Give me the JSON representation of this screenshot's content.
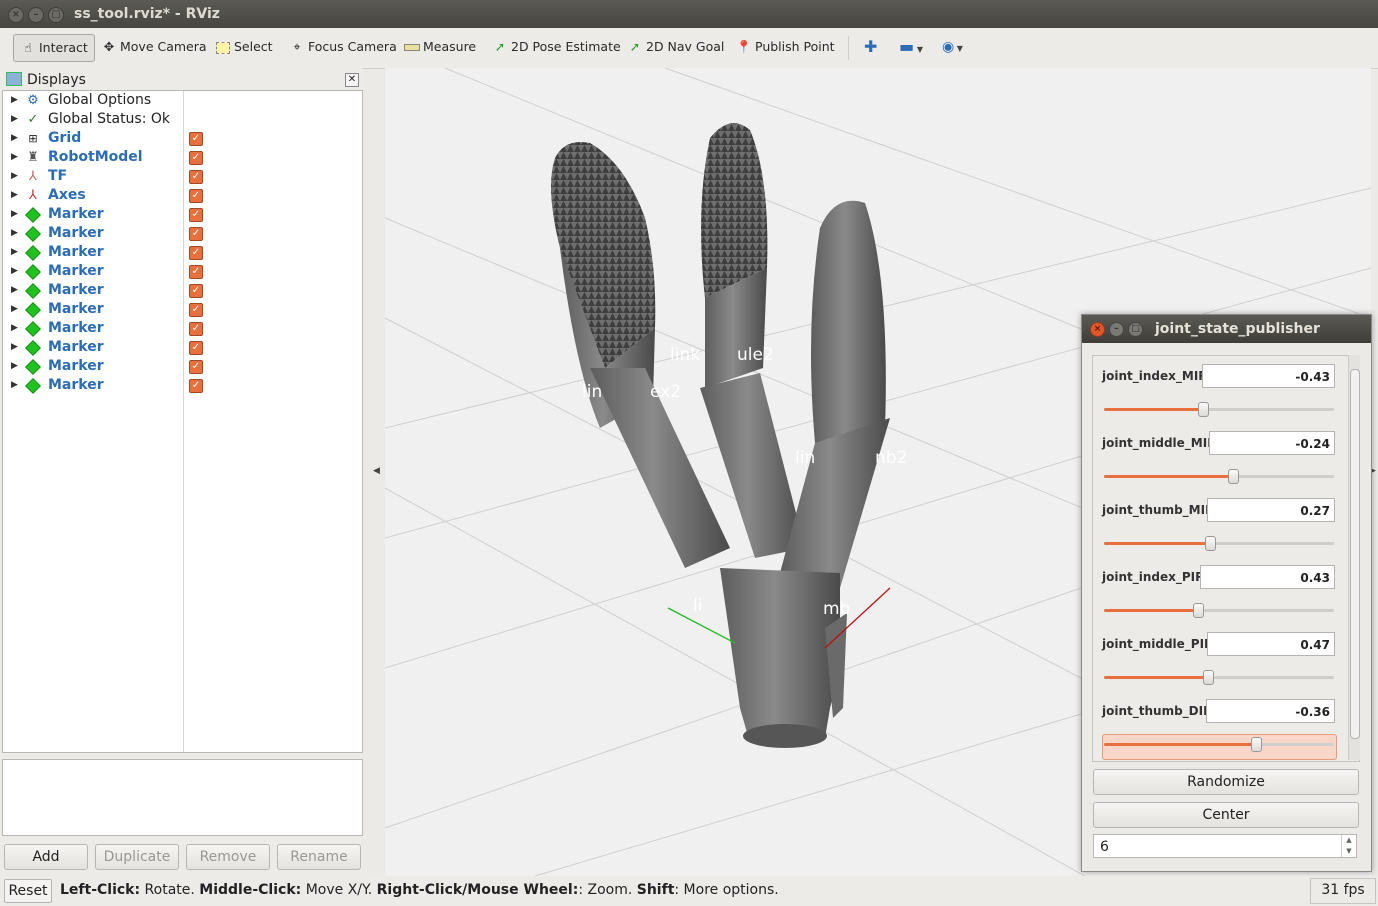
{
  "window": {
    "title": "ss_tool.rviz* - RViz"
  },
  "toolbar": {
    "items": [
      {
        "label": "Interact",
        "icon": "hand-icon"
      },
      {
        "label": "Move Camera",
        "icon": "move-camera-icon"
      },
      {
        "label": "Select",
        "icon": "select-icon"
      },
      {
        "label": "Focus Camera",
        "icon": "focus-camera-icon"
      },
      {
        "label": "Measure",
        "icon": "ruler-icon"
      },
      {
        "label": "2D Pose Estimate",
        "icon": "green-arrow-icon"
      },
      {
        "label": "2D Nav Goal",
        "icon": "green-arrow-icon"
      },
      {
        "label": "Publish Point",
        "icon": "map-pin-icon"
      }
    ]
  },
  "displays": {
    "title": "Displays",
    "rows": [
      {
        "label": "Global Options",
        "icon": "gear-icon",
        "checked": null
      },
      {
        "label": "Global Status: Ok",
        "icon": "checkmark-icon",
        "checked": null
      },
      {
        "label": "Grid",
        "icon": "grid-icon",
        "checked": true
      },
      {
        "label": "RobotModel",
        "icon": "robot-icon",
        "checked": true
      },
      {
        "label": "TF",
        "icon": "tf-icon",
        "checked": true
      },
      {
        "label": "Axes",
        "icon": "axes-icon",
        "checked": true
      },
      {
        "label": "Marker",
        "icon": "cube-icon",
        "checked": true
      },
      {
        "label": "Marker",
        "icon": "cube-icon",
        "checked": true
      },
      {
        "label": "Marker",
        "icon": "cube-icon",
        "checked": true
      },
      {
        "label": "Marker",
        "icon": "cube-icon",
        "checked": true
      },
      {
        "label": "Marker",
        "icon": "cube-icon",
        "checked": true
      },
      {
        "label": "Marker",
        "icon": "cube-icon",
        "checked": true
      },
      {
        "label": "Marker",
        "icon": "cube-icon",
        "checked": true
      },
      {
        "label": "Marker",
        "icon": "cube-icon",
        "checked": true
      },
      {
        "label": "Marker",
        "icon": "cube-icon",
        "checked": true
      },
      {
        "label": "Marker",
        "icon": "cube-icon",
        "checked": true
      }
    ],
    "buttons": {
      "add": "Add",
      "duplicate": "Duplicate",
      "remove": "Remove",
      "rename": "Rename"
    }
  },
  "viewport": {
    "labels": [
      "lin",
      "ex2",
      "link",
      "ule2",
      "lin",
      "nb2",
      "li",
      "mb"
    ]
  },
  "joint_state_publisher": {
    "title": "joint_state_publisher",
    "joints": [
      {
        "name": "joint_index_MIP",
        "value": "-0.43",
        "slider_fraction": 0.43
      },
      {
        "name": "joint_middle_MIP",
        "value": "-0.24",
        "slider_fraction": 0.56
      },
      {
        "name": "joint_thumb_MIP",
        "value": "0.27",
        "slider_fraction": 0.46
      },
      {
        "name": "joint_index_PIP",
        "value": "0.43",
        "slider_fraction": 0.41
      },
      {
        "name": "joint_middle_PIP",
        "value": "0.47",
        "slider_fraction": 0.45
      },
      {
        "name": "joint_thumb_DIP",
        "value": "-0.36",
        "slider_fraction": 0.66
      }
    ],
    "randomize_label": "Randomize",
    "center_label": "Center",
    "spinbox_value": "6"
  },
  "statusbar": {
    "reset_label": "Reset",
    "hint_parts": [
      {
        "bold": "Left-Click:",
        "text": " Rotate. "
      },
      {
        "bold": "Middle-Click:",
        "text": " Move X/Y. "
      },
      {
        "bold": "Right-Click/Mouse Wheel:",
        "text": ": Zoom. "
      },
      {
        "bold": "Shift",
        "text": ": More options."
      }
    ],
    "fps": "31 fps"
  },
  "colors": {
    "checkbox": "#e8703f",
    "display_label": "#2b6cb5",
    "title_bar": "#46453f",
    "marker_green": "#20c020"
  }
}
